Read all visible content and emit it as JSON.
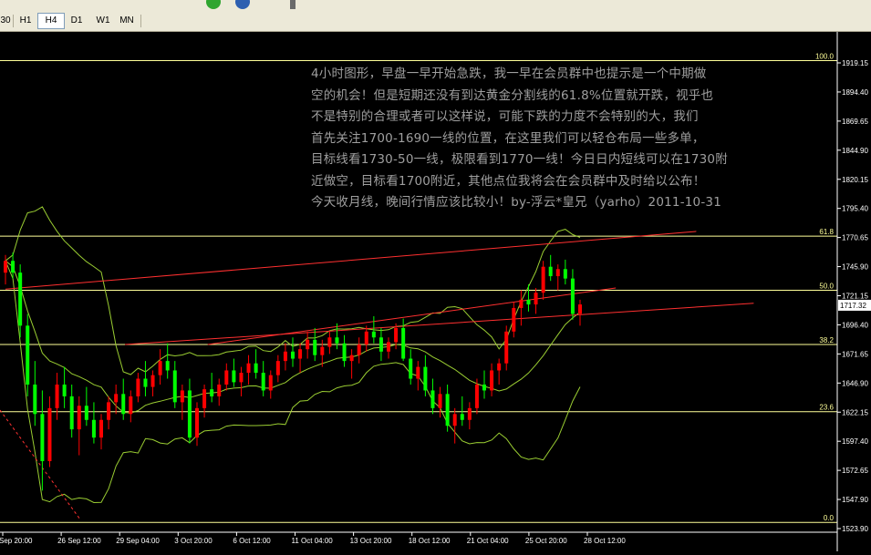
{
  "toolbar": {
    "icons": [
      "new-order-icon",
      "help-icon"
    ]
  },
  "timeframes": {
    "items": [
      "30",
      "H1",
      "H4",
      "D1",
      "W1",
      "MN"
    ],
    "active": "H4"
  },
  "annotation": {
    "text": "4小时图形，早盘一早开始急跌，我一早在会员群中也提示是一个中期做\n空的机会！但是短期还没有到达黄金分割线的61.8%位置就开跌，视乎也\n不是特别的合理或者可以这样说，可能下跌的力度不会特别的大，我们\n首先关注1700-1690一线的位置，在这里我们可以轻仓布局一些多单，\n目标线看1730-50一线，极限看到1770一线！今日日内短线可以在1730附\n近做空，目标看1700附近，其他点位我将会在会员群中及时给以公布！\n今天收月线，晚间行情应该比较小！by-浮云*皇兄（yarho）2011-10-31"
  },
  "colors": {
    "background": "#000000",
    "bull_candle": "#ff0000",
    "bear_candle": "#00ff00",
    "bollinger": "#9acd32",
    "fibonacci": "#ffff99",
    "trendline": "#ff3030",
    "price_tag_bg": "#ffffff",
    "axis_text": "#ffffff"
  },
  "chart_data": {
    "type": "candlestick",
    "timeframe": "H4",
    "y_ticks": [
      "1919.15",
      "1894.40",
      "1869.65",
      "1844.90",
      "1820.15",
      "1795.40",
      "1770.65",
      "1745.90",
      "1721.15",
      "1696.40",
      "1671.65",
      "1646.90",
      "1622.15",
      "1597.40",
      "1572.65",
      "1547.90",
      "1523.90"
    ],
    "x_ticks": [
      "Sep 20:00",
      "26 Sep 12:00",
      "29 Sep 04:00",
      "3 Oct 20:00",
      "6 Oct 12:00",
      "11 Oct 04:00",
      "13 Oct 20:00",
      "18 Oct 12:00",
      "21 Oct 04:00",
      "25 Oct 20:00",
      "28 Oct 12:00"
    ],
    "ylim": [
      1523.9,
      1930
    ],
    "current_price": "1717.32",
    "fibonacci_levels": [
      {
        "label": "100.0",
        "price": 1925
      },
      {
        "label": "61.8",
        "price": 1776
      },
      {
        "label": "50.0",
        "price": 1730
      },
      {
        "label": "38.2",
        "price": 1684
      },
      {
        "label": "23.6",
        "price": 1627
      },
      {
        "label": "0.0",
        "price": 1533
      }
    ],
    "trendlines": [
      {
        "from": [
          0,
          1731
        ],
        "to": [
          245,
          1780
        ]
      },
      {
        "from": [
          88,
          1684
        ],
        "to": [
          210,
          1732
        ]
      },
      {
        "from": [
          52,
          1684
        ],
        "to": [
          270,
          1719
        ]
      }
    ],
    "candles": [
      [
        1745,
        1760,
        1735,
        1755
      ],
      [
        1755,
        1762,
        1740,
        1745
      ],
      [
        1745,
        1752,
        1690,
        1700
      ],
      [
        1700,
        1710,
        1640,
        1650
      ],
      [
        1650,
        1670,
        1615,
        1625
      ],
      [
        1625,
        1645,
        1560,
        1585
      ],
      [
        1585,
        1640,
        1580,
        1630
      ],
      [
        1630,
        1660,
        1620,
        1650
      ],
      [
        1650,
        1665,
        1630,
        1640
      ],
      [
        1640,
        1650,
        1605,
        1612
      ],
      [
        1612,
        1640,
        1590,
        1632
      ],
      [
        1632,
        1648,
        1615,
        1620
      ],
      [
        1620,
        1635,
        1600,
        1605
      ],
      [
        1605,
        1625,
        1595,
        1620
      ],
      [
        1620,
        1640,
        1612,
        1635
      ],
      [
        1635,
        1650,
        1625,
        1642
      ],
      [
        1642,
        1655,
        1620,
        1625
      ],
      [
        1625,
        1645,
        1618,
        1640
      ],
      [
        1640,
        1660,
        1635,
        1655
      ],
      [
        1655,
        1670,
        1640,
        1648
      ],
      [
        1648,
        1662,
        1640,
        1658
      ],
      [
        1658,
        1680,
        1650,
        1670
      ],
      [
        1670,
        1685,
        1655,
        1662
      ],
      [
        1662,
        1670,
        1630,
        1635
      ],
      [
        1635,
        1650,
        1620,
        1645
      ],
      [
        1645,
        1655,
        1600,
        1605
      ],
      [
        1605,
        1635,
        1598,
        1630
      ],
      [
        1630,
        1650,
        1622,
        1646
      ],
      [
        1646,
        1660,
        1635,
        1640
      ],
      [
        1640,
        1655,
        1632,
        1650
      ],
      [
        1650,
        1668,
        1645,
        1662
      ],
      [
        1662,
        1672,
        1648,
        1652
      ],
      [
        1652,
        1665,
        1640,
        1660
      ],
      [
        1660,
        1675,
        1650,
        1668
      ],
      [
        1668,
        1680,
        1655,
        1660
      ],
      [
        1660,
        1670,
        1640,
        1645
      ],
      [
        1645,
        1662,
        1638,
        1658
      ],
      [
        1658,
        1675,
        1652,
        1670
      ],
      [
        1670,
        1685,
        1662,
        1678
      ],
      [
        1678,
        1690,
        1665,
        1672
      ],
      [
        1672,
        1685,
        1660,
        1680
      ],
      [
        1680,
        1695,
        1672,
        1688
      ],
      [
        1688,
        1698,
        1670,
        1675
      ],
      [
        1675,
        1688,
        1665,
        1682
      ],
      [
        1682,
        1695,
        1676,
        1690
      ],
      [
        1690,
        1702,
        1680,
        1685
      ],
      [
        1685,
        1692,
        1665,
        1670
      ],
      [
        1670,
        1680,
        1655,
        1675
      ],
      [
        1675,
        1690,
        1668,
        1684
      ],
      [
        1684,
        1700,
        1678,
        1695
      ],
      [
        1695,
        1708,
        1685,
        1690
      ],
      [
        1690,
        1698,
        1670,
        1678
      ],
      [
        1678,
        1690,
        1672,
        1686
      ],
      [
        1686,
        1702,
        1680,
        1698
      ],
      [
        1698,
        1706,
        1670,
        1672
      ],
      [
        1672,
        1680,
        1650,
        1655
      ],
      [
        1655,
        1670,
        1645,
        1665
      ],
      [
        1665,
        1675,
        1640,
        1645
      ],
      [
        1645,
        1655,
        1625,
        1630
      ],
      [
        1630,
        1648,
        1622,
        1642
      ],
      [
        1642,
        1650,
        1610,
        1615
      ],
      [
        1615,
        1630,
        1600,
        1625
      ],
      [
        1625,
        1640,
        1615,
        1620
      ],
      [
        1620,
        1635,
        1612,
        1630
      ],
      [
        1630,
        1655,
        1625,
        1650
      ],
      [
        1650,
        1662,
        1638,
        1645
      ],
      [
        1645,
        1668,
        1640,
        1662
      ],
      [
        1662,
        1672,
        1650,
        1668
      ],
      [
        1668,
        1700,
        1662,
        1695
      ],
      [
        1695,
        1720,
        1690,
        1715
      ],
      [
        1715,
        1730,
        1700,
        1722
      ],
      [
        1722,
        1735,
        1712,
        1718
      ],
      [
        1718,
        1732,
        1710,
        1728
      ],
      [
        1728,
        1755,
        1722,
        1750
      ],
      [
        1750,
        1760,
        1738,
        1742
      ],
      [
        1742,
        1752,
        1730,
        1748
      ],
      [
        1748,
        1756,
        1735,
        1740
      ],
      [
        1740,
        1748,
        1705,
        1710
      ],
      [
        1710,
        1722,
        1700,
        1718
      ]
    ]
  }
}
